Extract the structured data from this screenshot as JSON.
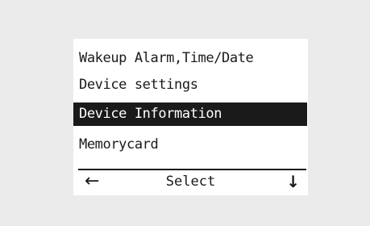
{
  "menu": {
    "items": [
      {
        "label": "Wakeup Alarm,Time/Date"
      },
      {
        "label": "Device settings"
      },
      {
        "label": "Device Information"
      },
      {
        "label": "Memorycard"
      }
    ],
    "selected_index": 2
  },
  "softkeys": {
    "left_icon": "←",
    "left_icon_name": "left-arrow-icon",
    "center_label": "Select",
    "right_icon": "↓",
    "right_icon_name": "down-arrow-icon"
  },
  "colors": {
    "background": "#ebebeb",
    "screen": "#ffffff",
    "ink": "#1a1a1a",
    "highlight_text": "#ffffff"
  }
}
